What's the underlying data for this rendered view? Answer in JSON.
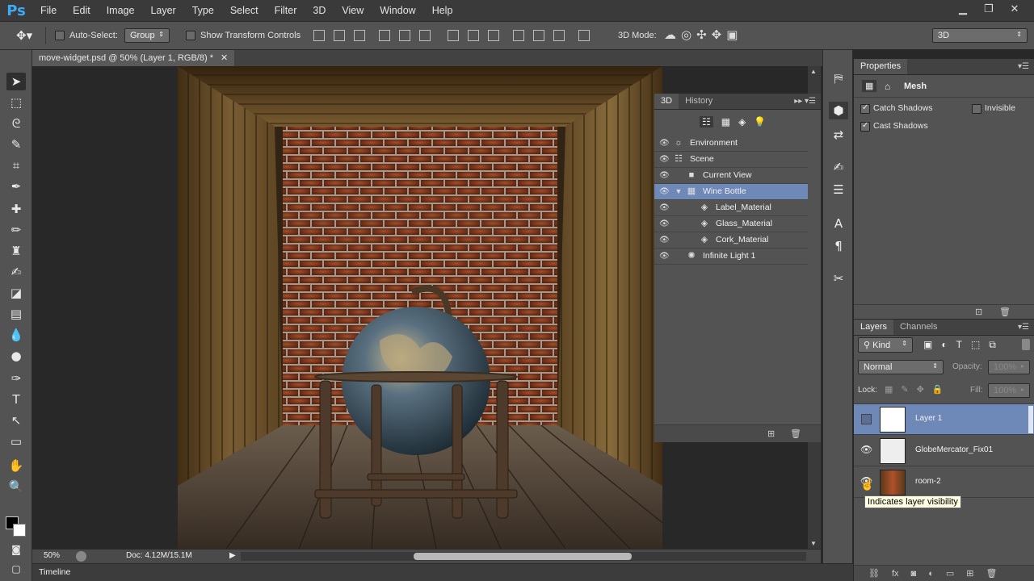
{
  "app": {
    "logo": "Ps"
  },
  "menu": [
    "File",
    "Edit",
    "Image",
    "Layer",
    "Type",
    "Select",
    "Filter",
    "3D",
    "View",
    "Window",
    "Help"
  ],
  "window_controls": {
    "minimize": "▁",
    "restore": "❐",
    "close": "✕"
  },
  "options_bar": {
    "auto_select_label": "Auto-Select:",
    "auto_select_value": "Group",
    "show_transform_label": "Show Transform Controls",
    "mode_label": "3D Mode:",
    "workspace_value": "3D"
  },
  "document": {
    "tab_title": "move-widget.psd @ 50% (Layer 1, RGB/8) *",
    "zoom": "50%",
    "doc_info": "Doc: 4.12M/15.1M"
  },
  "timeline": {
    "label": "Timeline"
  },
  "panel_3d": {
    "tabs": [
      "3D",
      "History"
    ],
    "rows": [
      {
        "label": "Environment",
        "icon": "environment-icon"
      },
      {
        "label": "Scene",
        "icon": "scene-icon"
      },
      {
        "label": "Current View",
        "icon": "camera-icon"
      },
      {
        "label": "Wine Bottle",
        "icon": "mesh-icon",
        "selected": true
      },
      {
        "label": "Label_Material",
        "icon": "material-icon"
      },
      {
        "label": "Glass_Material",
        "icon": "material-icon"
      },
      {
        "label": "Cork_Material",
        "icon": "material-icon"
      },
      {
        "label": "Infinite Light 1",
        "icon": "light-icon"
      }
    ]
  },
  "properties": {
    "tab": "Properties",
    "section": "Mesh",
    "catch_shadows": "Catch Shadows",
    "invisible": "Invisible",
    "cast_shadows": "Cast Shadows"
  },
  "layers_panel": {
    "tabs": [
      "Layers",
      "Channels"
    ],
    "kind_value": "Kind",
    "blend_mode": "Normal",
    "opacity_label": "Opacity:",
    "opacity_value": "100%",
    "lock_label": "Lock:",
    "fill_label": "Fill:",
    "fill_value": "100%",
    "layers": [
      {
        "name": "Layer 1",
        "selected": true,
        "visible": false
      },
      {
        "name": "GlobeMercator_Fix01",
        "selected": false,
        "visible": true
      },
      {
        "name": "room-2",
        "selected": false,
        "visible": true
      }
    ],
    "tooltip": "Indicates layer visibility"
  },
  "colors": {
    "selection": "#6e89b8",
    "panel": "#535353",
    "ps_blue": "#3fa9f5"
  }
}
